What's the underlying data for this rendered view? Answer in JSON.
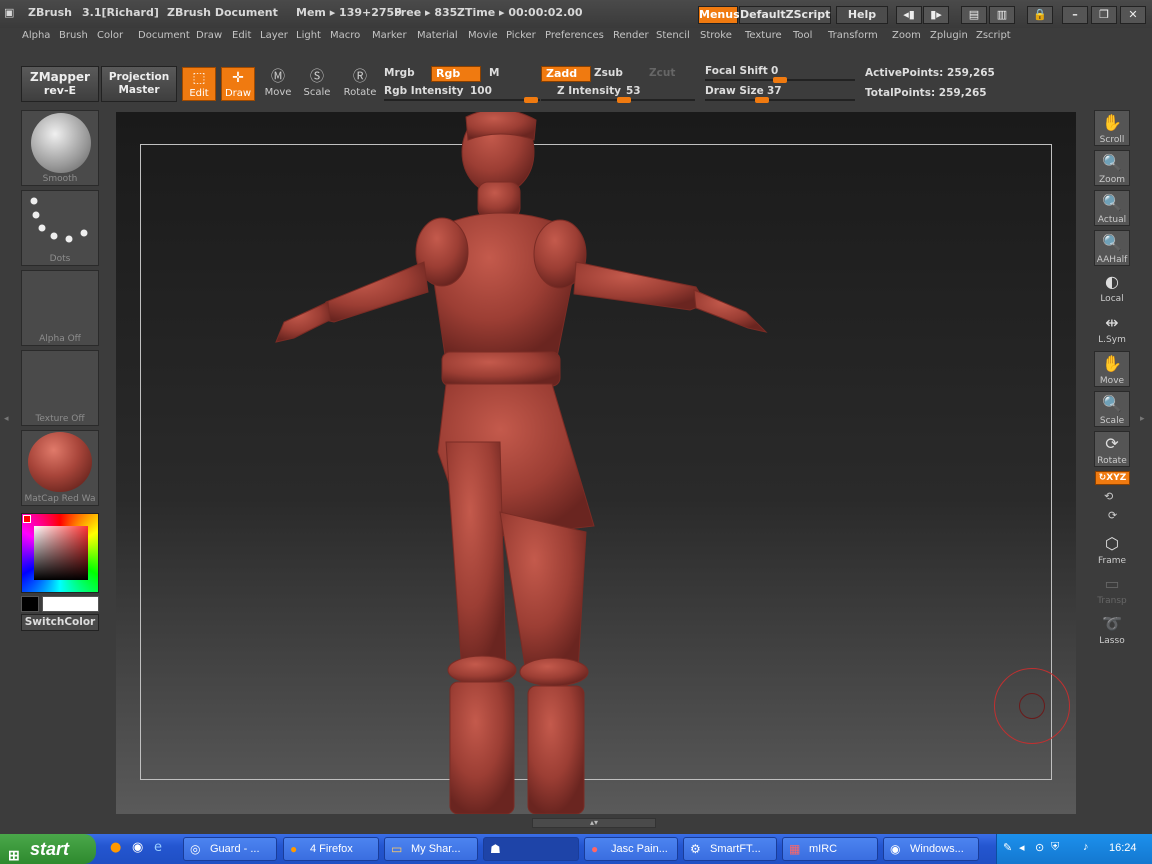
{
  "titlebar": {
    "app": "ZBrush",
    "version": "3.1[Richard]",
    "document": "ZBrush Document",
    "mem": "Mem ▸ 139+2759",
    "free": "Free ▸ 835",
    "ztime": "ZTime ▸ 00:00:02.00",
    "menus_btn": "Menus",
    "script_btn": "DefaultZScript",
    "help_btn": "Help"
  },
  "menubar": [
    "Alpha",
    "Brush",
    "Color",
    "Document",
    "Draw",
    "Edit",
    "Layer",
    "Light",
    "Macro",
    "Marker",
    "Material",
    "Movie",
    "Picker",
    "Preferences",
    "Render",
    "Stencil",
    "Stroke",
    "Texture",
    "Tool",
    "Transform",
    "Zoom",
    "Zplugin",
    "Zscript"
  ],
  "toolbar": {
    "zmapper_l1": "ZMapper",
    "zmapper_l2": "rev-E",
    "projection_l1": "Projection",
    "projection_l2": "Master",
    "edit": "Edit",
    "draw": "Draw",
    "move": "Move",
    "scale": "Scale",
    "rotate": "Rotate",
    "mrgb": "Mrgb",
    "rgb": "Rgb",
    "m": "M",
    "rgb_intensity_label": "Rgb Intensity",
    "rgb_intensity": "100",
    "zadd": "Zadd",
    "zsub": "Zsub",
    "zcut": "Zcut",
    "z_intensity_label": "Z Intensity",
    "z_intensity": "53",
    "focal_shift_label": "Focal Shift",
    "focal_shift": "0",
    "draw_size_label": "Draw Size",
    "draw_size": "37",
    "active_points": "ActivePoints: 259,265",
    "total_points": "TotalPoints: 259,265"
  },
  "left_palette": {
    "brush": "Smooth",
    "stroke": "Dots",
    "alpha": "Alpha  Off",
    "texture": "Texture  Off",
    "material": "MatCap  Red  Wa",
    "switch_color": "SwitchColor"
  },
  "right_palette": {
    "scroll": "Scroll",
    "zoom": "Zoom",
    "actual": "Actual",
    "aahalf": "AAHalf",
    "local": "Local",
    "lsym": "L.Sym",
    "move": "Move",
    "scale": "Scale",
    "rotate": "Rotate",
    "xyz": "XYZ",
    "frame": "Frame",
    "transp": "Transp",
    "lasso": "Lasso"
  },
  "colors": {
    "accent": "#f07a10",
    "model": "#a8453a",
    "main_color": "#ffffff",
    "secondary_color": "#000000"
  },
  "taskbar": {
    "start": "start",
    "tasks": [
      "Guard - ...",
      "4 Firefox",
      "My Shar...",
      "",
      "Jasc Pain...",
      "SmartFT...",
      "mIRC",
      "Windows..."
    ],
    "clock": "16:24"
  }
}
